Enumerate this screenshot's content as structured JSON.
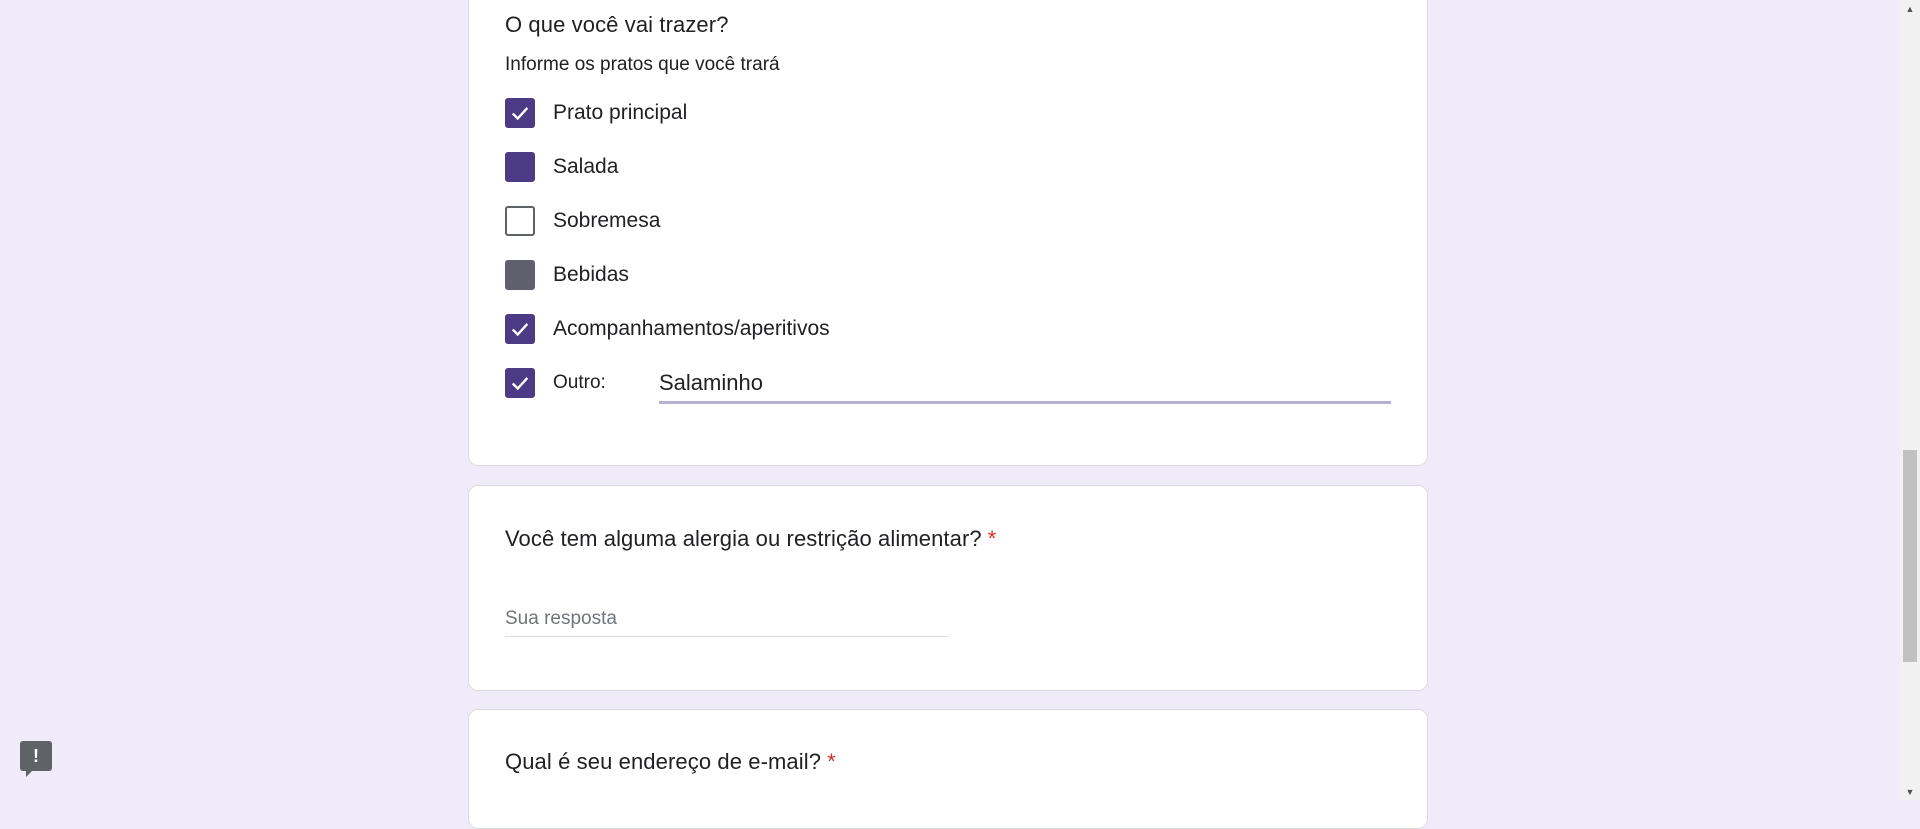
{
  "question1": {
    "title": "O que você vai trazer?",
    "description": "Informe os pratos que você trará",
    "options": [
      {
        "label": "Prato principal",
        "state": "checked"
      },
      {
        "label": "Salada",
        "state": "filled"
      },
      {
        "label": "Sobremesa",
        "state": "unchecked"
      },
      {
        "label": "Bebidas",
        "state": "grey"
      },
      {
        "label": "Acompanhamentos/aperitivos",
        "state": "checked"
      }
    ],
    "other": {
      "label": "Outro:",
      "value": "Salaminho",
      "state": "checked"
    }
  },
  "question2": {
    "title": "Você tem alguma alergia ou restrição alimentar?",
    "required_mark": "*",
    "placeholder": "Sua resposta"
  },
  "question3": {
    "title": "Qual é seu endereço de e-mail?",
    "required_mark": "*"
  },
  "feedback": {
    "icon": "feedback-icon",
    "glyph": "!"
  },
  "colors": {
    "background": "#f0ebf8",
    "accent": "#4b3b84",
    "required": "#d93025"
  }
}
